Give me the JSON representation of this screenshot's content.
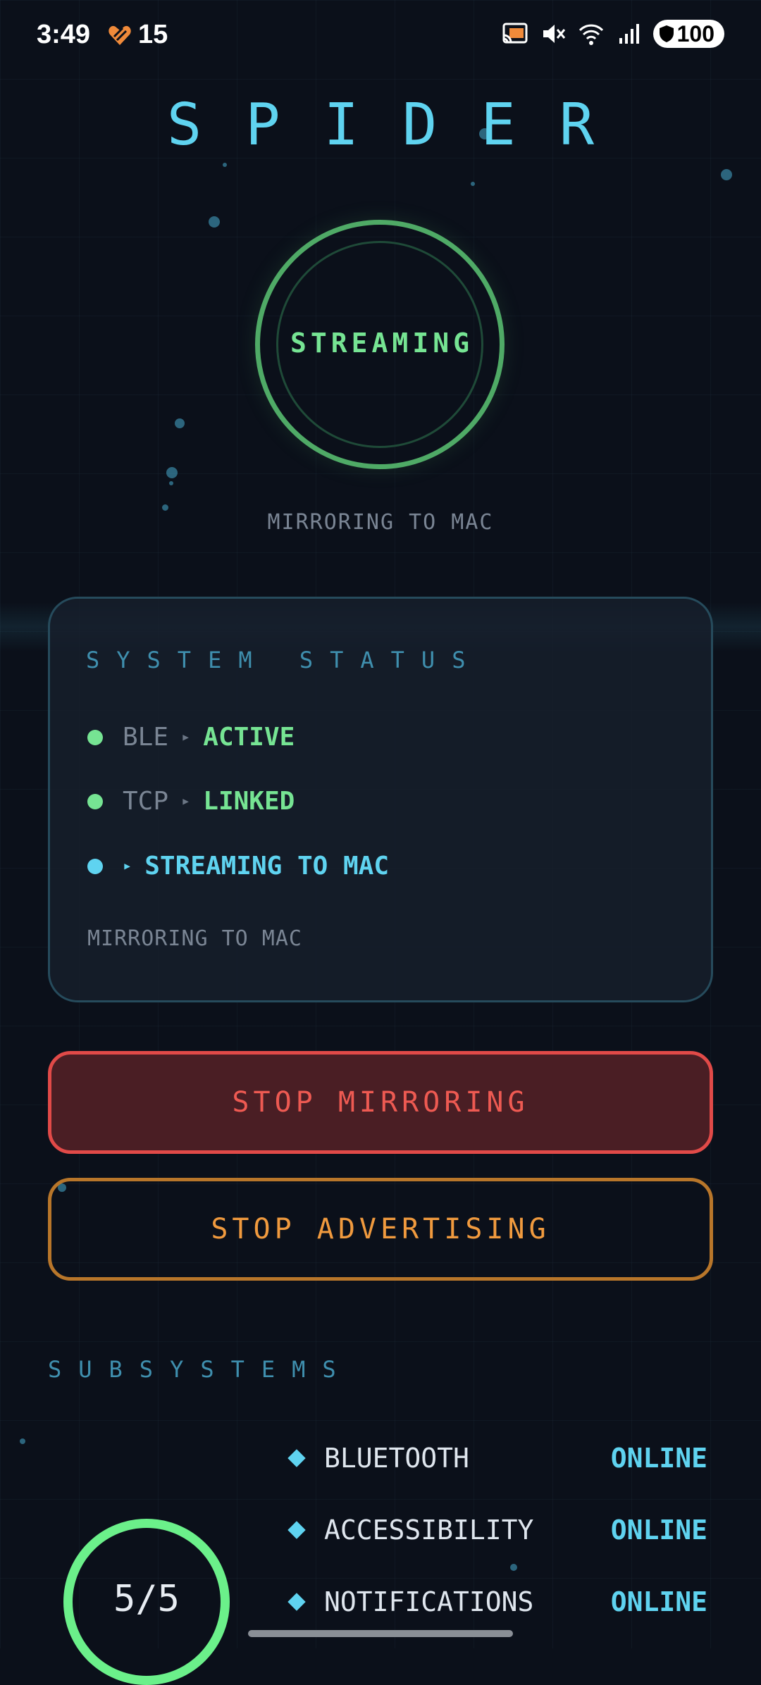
{
  "status_bar": {
    "time": "3:49",
    "notification_count": "15",
    "battery": "100",
    "icons": [
      "cast-icon",
      "mute-icon",
      "wifi-icon",
      "signal-icon",
      "battery-icon"
    ]
  },
  "app": {
    "title": "SPIDER",
    "ring_label": "STREAMING",
    "subtitle": "MIRRORING TO MAC"
  },
  "system_status": {
    "title": "SYSTEM STATUS",
    "rows": [
      {
        "key": "BLE",
        "value": "ACTIVE",
        "led_color": "#76e493"
      },
      {
        "key": "TCP",
        "value": "LINKED",
        "led_color": "#76e493"
      },
      {
        "key": "",
        "value": "STREAMING TO MAC",
        "led_color": "#5fd3f0"
      }
    ],
    "footer": "MIRRORING TO MAC"
  },
  "buttons": {
    "stop_mirroring": "STOP MIRRORING",
    "stop_advertising": "STOP ADVERTISING"
  },
  "subsystems": {
    "title": "SUBSYSTEMS",
    "summary": "5/5",
    "items": [
      {
        "name": "BLUETOOTH",
        "state": "ONLINE"
      },
      {
        "name": "ACCESSIBILITY",
        "state": "ONLINE"
      },
      {
        "name": "NOTIFICATIONS",
        "state": "ONLINE"
      }
    ]
  },
  "colors": {
    "background": "#0b101a",
    "accent_cyan": "#5fd3f0",
    "accent_green": "#76e493",
    "danger": "#e14a48",
    "warning": "#f09a3e"
  }
}
